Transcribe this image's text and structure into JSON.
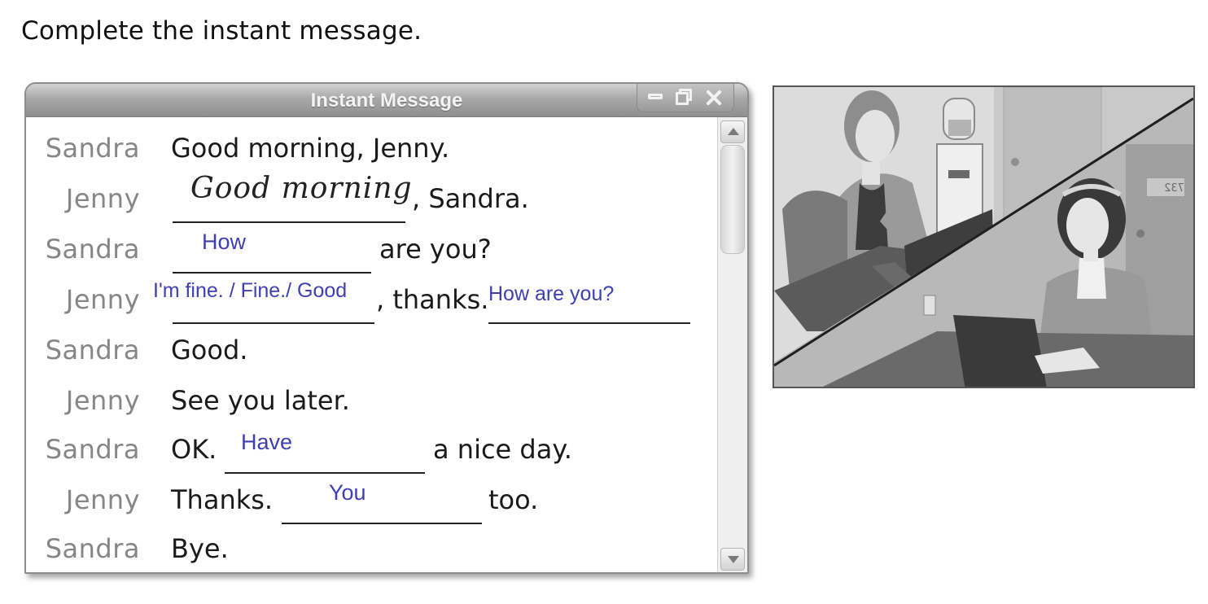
{
  "instruction": "Complete the instant message.",
  "window": {
    "title": "Instant Message",
    "controls": [
      "minimize-icon",
      "maximize-icon",
      "close-icon"
    ]
  },
  "conversation": {
    "sandra_1": {
      "speaker": "Sandra",
      "text": "Good morning, Jenny."
    },
    "jenny_1": {
      "speaker": "Jenny",
      "answer": "Good morning",
      "after": ", Sandra."
    },
    "sandra_2": {
      "speaker": "Sandra",
      "answer": "How",
      "after": "are you?"
    },
    "jenny_2": {
      "speaker": "Jenny",
      "answer": "I'm fine. / Fine./ Good",
      "middle": ", thanks.",
      "answer2": "How are you?"
    },
    "sandra_3": {
      "speaker": "Sandra",
      "text": "Good."
    },
    "jenny_3": {
      "speaker": "Jenny",
      "text": "See you later."
    },
    "sandra_4": {
      "speaker": "Sandra",
      "before": "OK.",
      "answer": "Have",
      "after": "a nice day."
    },
    "jenny_4": {
      "speaker": "Jenny",
      "before": "Thanks.",
      "answer": "You",
      "after": "too."
    },
    "sandra_5": {
      "speaker": "Sandra",
      "text": "Bye."
    }
  },
  "illustration": {
    "door_number": "732"
  },
  "colors": {
    "speaker": "#868686",
    "answer": "#3f3fb5",
    "titlebar": "#a8a8a8"
  }
}
